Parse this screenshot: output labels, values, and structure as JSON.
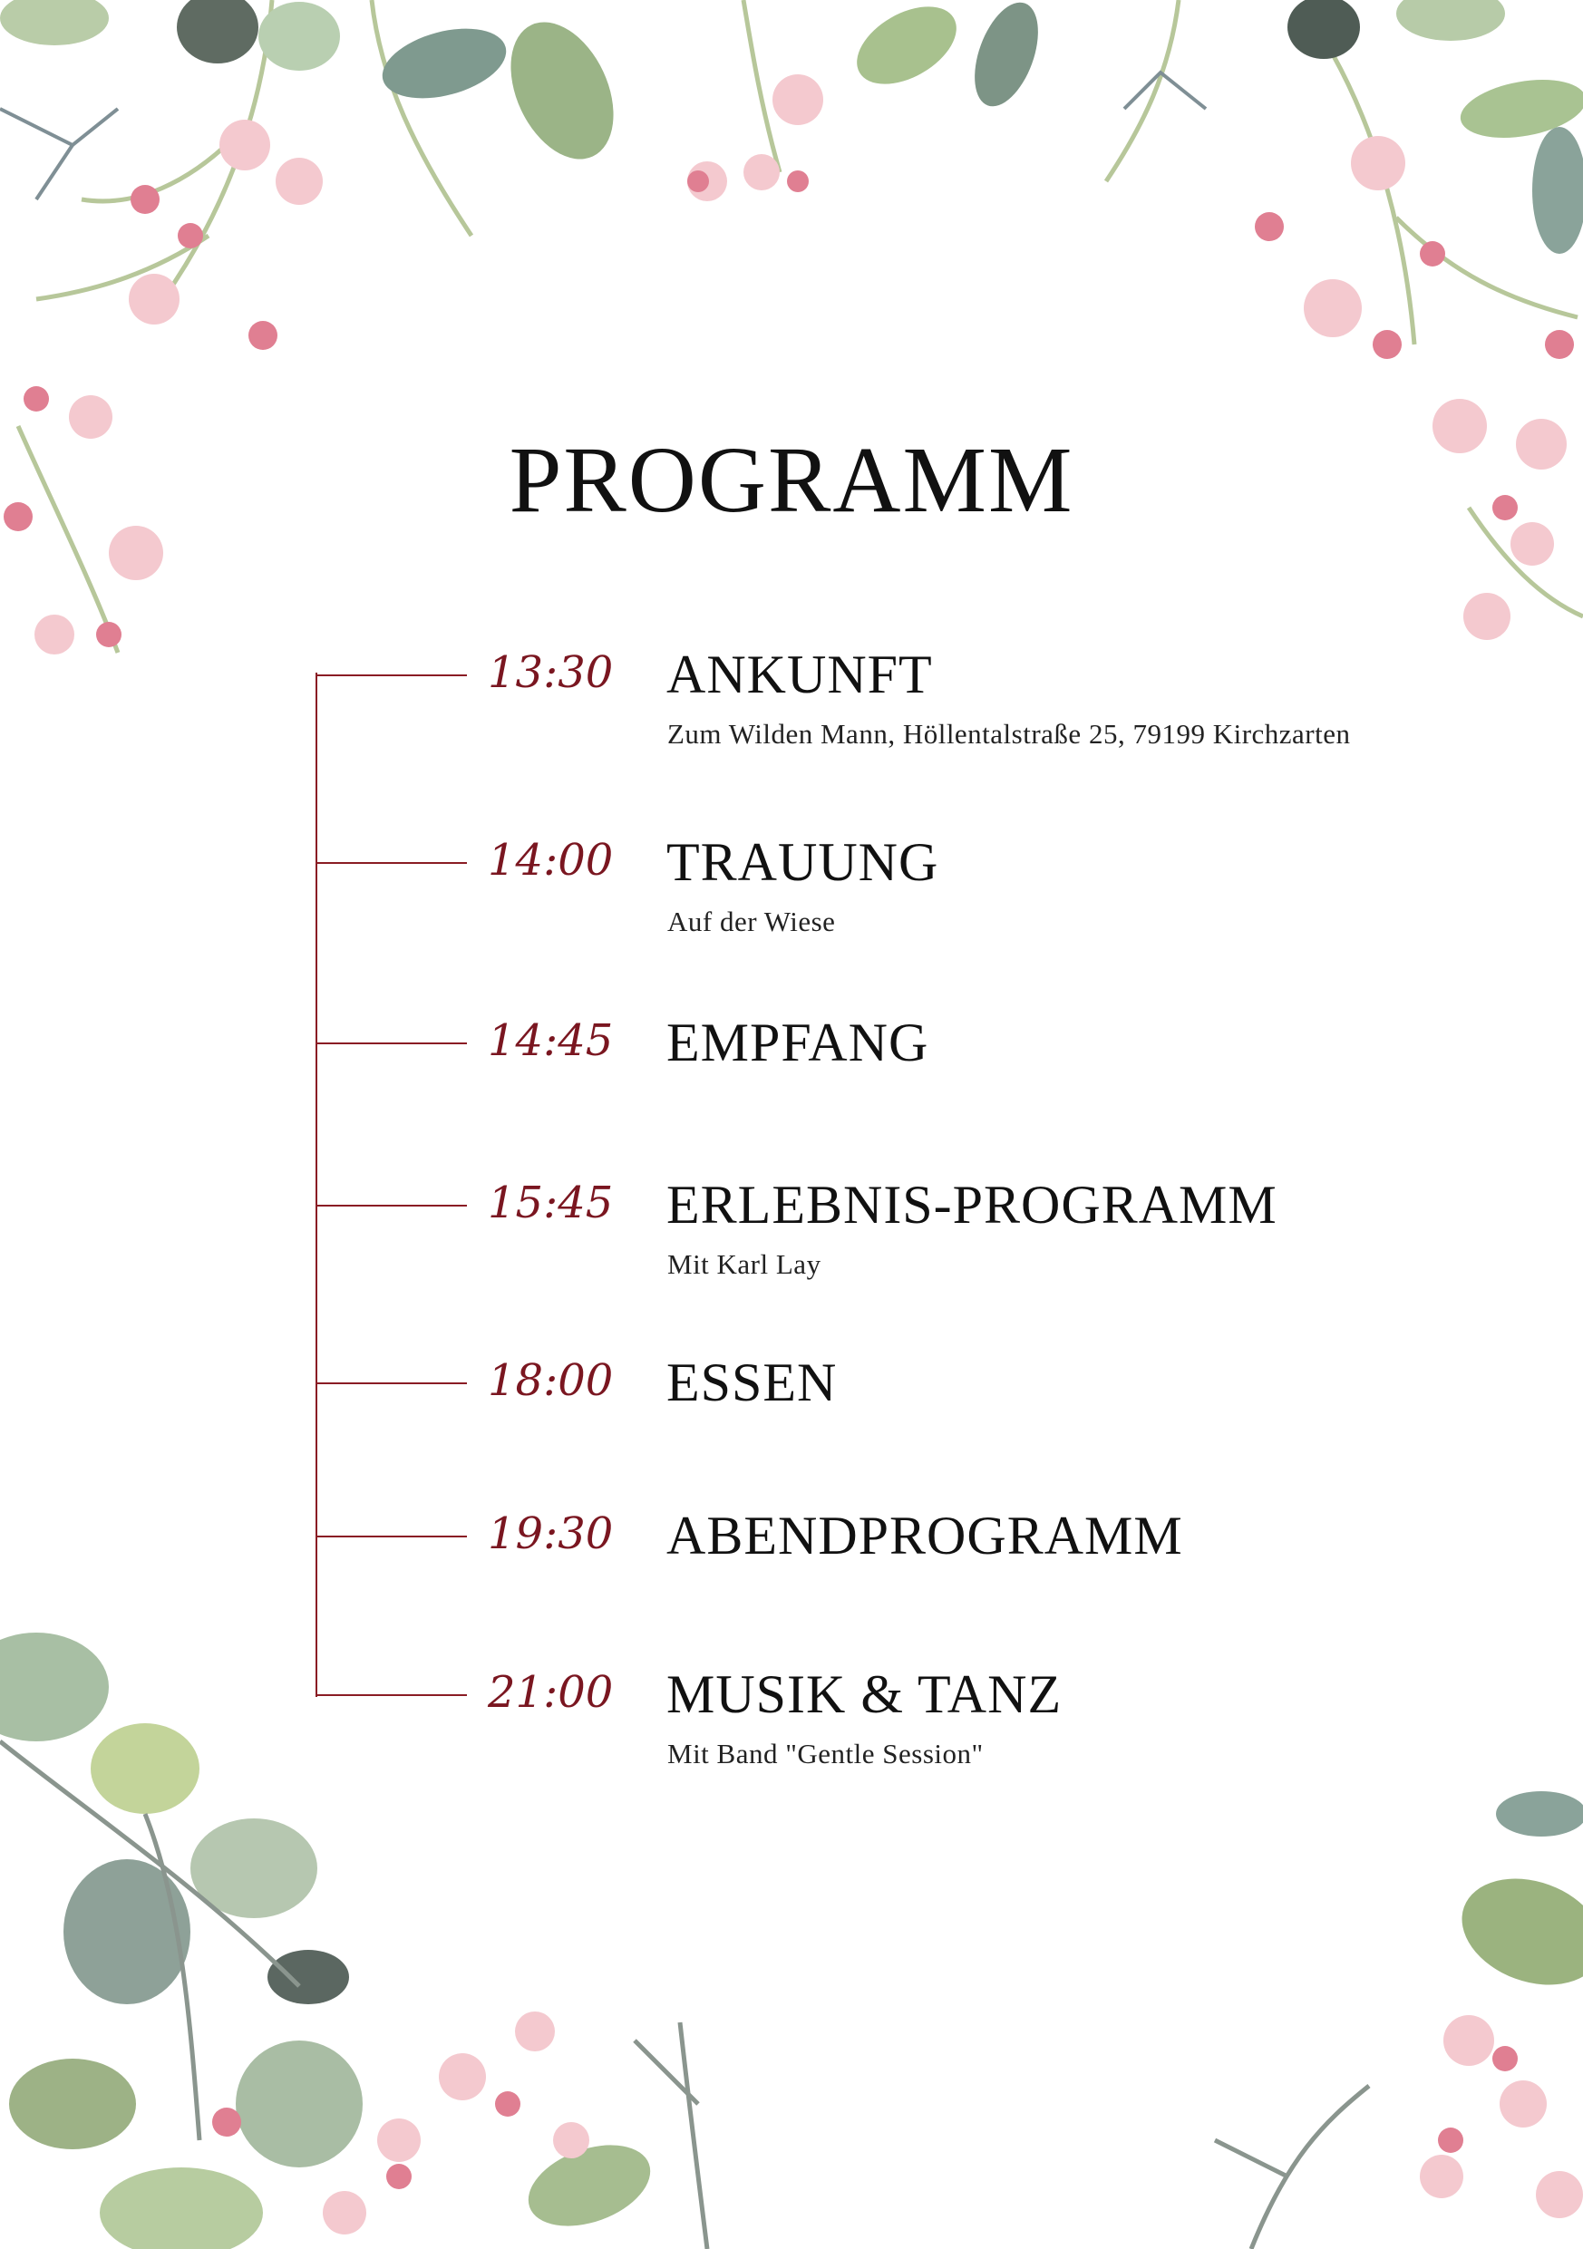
{
  "document": {
    "title": "PROGRAMM",
    "accent_color": "#8a1c24",
    "events": [
      {
        "time": "13:30",
        "name": "ANKUNFT",
        "detail": "Zum Wilden Mann, Höllentalstraße 25, 79199 Kirchzarten"
      },
      {
        "time": "14:00",
        "name": "TRAUUNG",
        "detail": "Auf der Wiese"
      },
      {
        "time": "14:45",
        "name": "EMPFANG",
        "detail": ""
      },
      {
        "time": "15:45",
        "name": "ERLEBNIS-PROGRAMM",
        "detail": "Mit Karl Lay"
      },
      {
        "time": "18:00",
        "name": "ESSEN",
        "detail": ""
      },
      {
        "time": "19:30",
        "name": "ABENDPROGRAMM",
        "detail": ""
      },
      {
        "time": "21:00",
        "name": "MUSIK & TANZ",
        "detail": "Mit Band \"Gentle Session\""
      }
    ]
  }
}
